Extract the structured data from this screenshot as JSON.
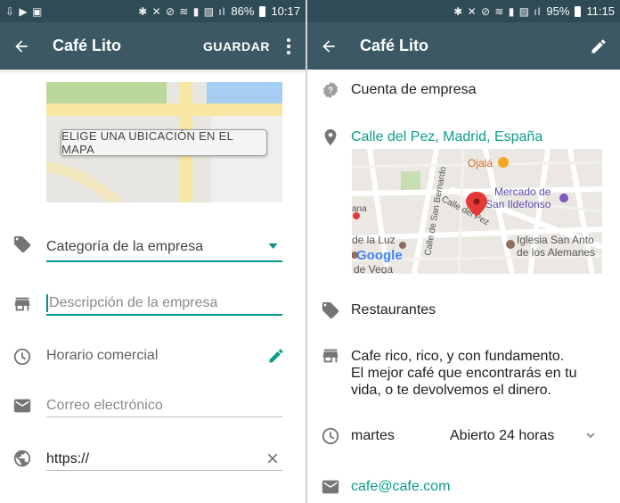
{
  "left": {
    "status": {
      "left_icons": "⇩ ▶ ▣",
      "right_icons": "✱ ✕ ⊘ ≋ ▮ ▨ ıl",
      "battery": "86%",
      "time": "10:17"
    },
    "appbar": {
      "title": "Café Lito",
      "save_label": "GUARDAR"
    },
    "map_button": "ELIGE UNA UBICACIÓN EN EL MAPA",
    "fields": {
      "category": "Categoría de la empresa",
      "description_placeholder": "Descripción de la empresa",
      "hours": "Horario comercial",
      "email_placeholder": "Correo electrónico",
      "website": "https://"
    }
  },
  "right": {
    "status": {
      "right_icons": "✱ ✕ ⊘ ≋ ▮ ▨ ıl",
      "battery": "95%",
      "time": "11:15"
    },
    "appbar": {
      "title": "Café Lito"
    },
    "account_type": "Cuenta de empresa",
    "address": "Calle del Pez, Madrid, España",
    "map_labels": {
      "ojala": "Ojalá",
      "mercado_1": "Mercado de",
      "mercado_2": "San Ildefonso",
      "calle_pez": "Calle del Pez",
      "san_bernardo": "Calle de San Bernardo",
      "iglesia_1": "Iglesia San Anto",
      "iglesia_2": "de los Alemanes",
      "de_la_luz": "de la Luz",
      "de_vega": "de Vega",
      "ana": "ana",
      "google": "Google"
    },
    "category": "Restaurantes",
    "description": [
      "Cafe rico, rico, y con fundamento.",
      "El mejor café que encontrarás en tu",
      "vida, o te devolvemos el dinero."
    ],
    "hours_day": "martes",
    "hours_value": "Abierto 24 horas",
    "email": "cafe@cafe.com"
  },
  "colors": {
    "appbar": "#3b5864",
    "statusbar": "#2f4b56",
    "accent": "#009688",
    "link": "#0b9d8a",
    "icon_gray": "#757575"
  }
}
